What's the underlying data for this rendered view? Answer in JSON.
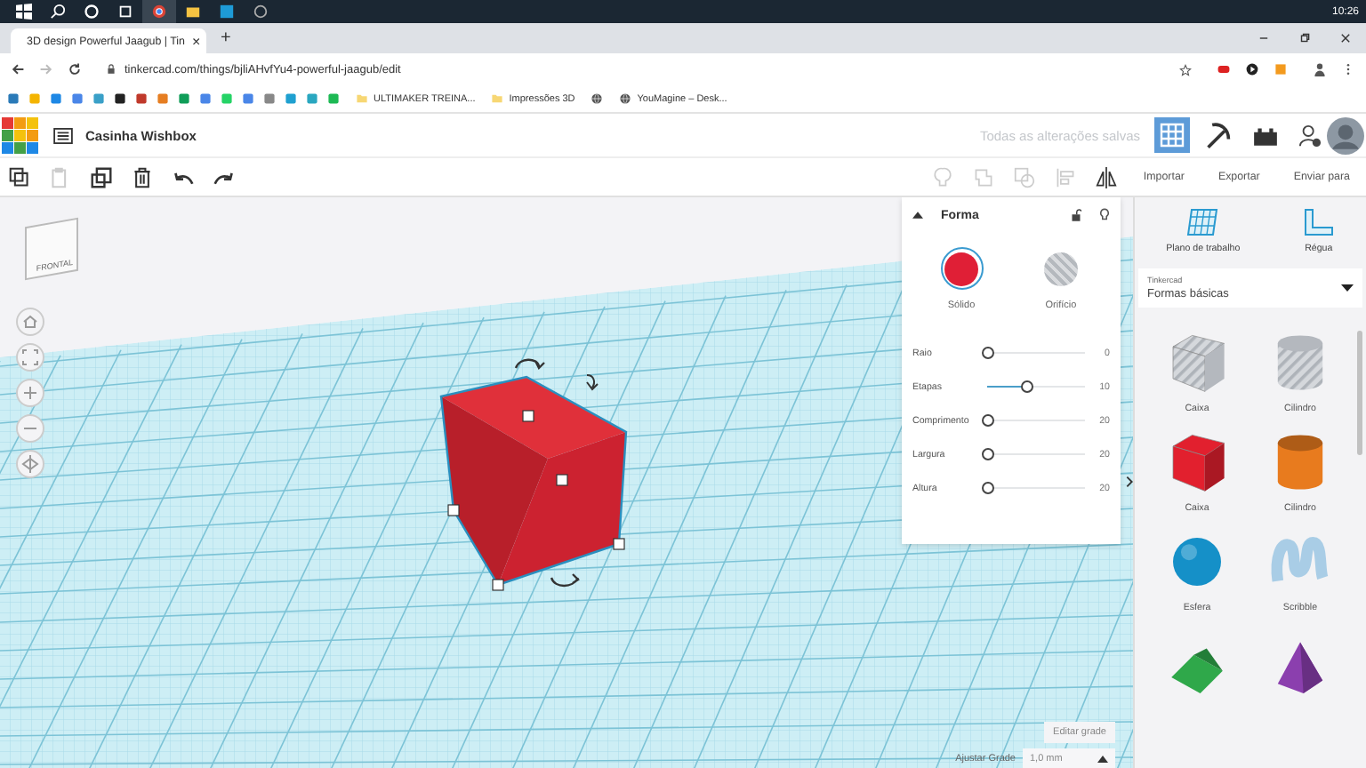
{
  "taskbar": {
    "clock": "10:26"
  },
  "browser": {
    "tab_title": "3D design Powerful Jaagub | Tin",
    "tab_close": "×",
    "new_tab": "+",
    "url": "tinkercad.com/things/bjliAHvfYu4-powerful-jaagub/edit",
    "bookmarks": [
      {
        "kind": "folder",
        "label": "ULTIMAKER TREINA..."
      },
      {
        "kind": "folder",
        "label": "Impressões 3D"
      },
      {
        "kind": "globe"
      },
      {
        "kind": "globe",
        "label": "YouMagine – Desk..."
      }
    ]
  },
  "app": {
    "title": "Casinha Wishbox",
    "save_status": "Todas as alterações salvas",
    "view_buttons": [
      {
        "kind": "grid",
        "selected": true
      },
      {
        "kind": "pickaxe",
        "selected": false
      },
      {
        "kind": "bricks",
        "selected": false
      }
    ]
  },
  "toolbar": {
    "actions": [
      {
        "kind": "copy",
        "disabled": false
      },
      {
        "kind": "paste",
        "disabled": true
      },
      {
        "kind": "duplicate",
        "disabled": false
      },
      {
        "kind": "delete",
        "disabled": false
      },
      {
        "kind": "undo",
        "disabled": false
      },
      {
        "kind": "redo",
        "disabled": false
      }
    ],
    "buttons": [
      "Importar",
      "Exportar",
      "Enviar para"
    ]
  },
  "view_cube": {
    "label": "FRONTAL"
  },
  "inspector": {
    "title": "Forma",
    "modes": [
      {
        "kind": "solid",
        "label": "Sólido",
        "selected": true
      },
      {
        "kind": "hole",
        "label": "Orifício",
        "selected": false
      }
    ],
    "params": [
      {
        "label": "Raio",
        "value": "0",
        "level": 0
      },
      {
        "label": "Etapas",
        "value": "10",
        "level": 0.4
      },
      {
        "label": "Comprimento",
        "value": "20",
        "level": 0
      },
      {
        "label": "Largura",
        "value": "20",
        "level": 0
      },
      {
        "label": "Altura",
        "value": "20",
        "level": 0
      }
    ]
  },
  "grid": {
    "edit_button": "Editar grade",
    "snap_label": "Ajustar Grade",
    "snap_value": "1,0 mm"
  },
  "library": {
    "tools": [
      {
        "kind": "workplane",
        "label": "Plano de trabalho"
      },
      {
        "kind": "ruler",
        "label": "Régua"
      }
    ],
    "source": "Tinkercad",
    "category": "Formas básicas",
    "shapes": [
      {
        "kind": "box",
        "hole": true,
        "label": "Caixa"
      },
      {
        "kind": "cylinder",
        "hole": true,
        "label": "Cilindro"
      },
      {
        "kind": "box",
        "hole": false,
        "color": "#e2202e",
        "label": "Caixa"
      },
      {
        "kind": "cylinder",
        "hole": false,
        "color": "#e87b1e",
        "label": "Cilindro"
      },
      {
        "kind": "sphere",
        "hole": false,
        "color": "#1590c8",
        "label": "Esfera"
      },
      {
        "kind": "scribble",
        "hole": false,
        "color": "#a9cde6",
        "label": "Scribble"
      },
      {
        "kind": "roof",
        "hole": false,
        "color": "#2fa84a"
      },
      {
        "kind": "cone",
        "hole": false,
        "color": "#8b3fae"
      }
    ]
  }
}
